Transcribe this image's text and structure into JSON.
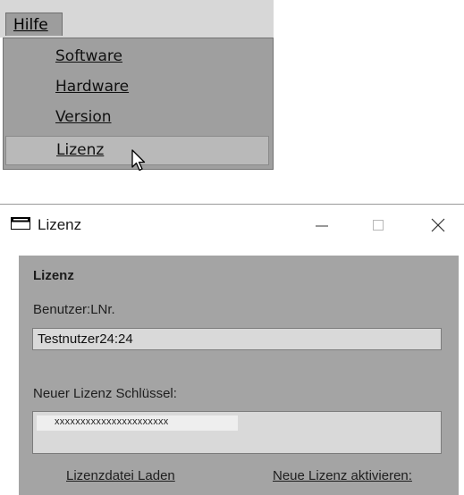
{
  "menu": {
    "top_label": "Hilfe",
    "items": [
      {
        "label": "Software"
      },
      {
        "label": "Hardware"
      },
      {
        "label": "Version"
      },
      {
        "label": "Lizenz",
        "highlighted": true
      }
    ]
  },
  "dialog": {
    "title": "Lizenz",
    "window_controls": {
      "minimize_icon": "minimize-icon",
      "maximize_icon": "maximize-icon",
      "close_icon": "close-icon"
    },
    "group_title": "Lizenz",
    "user_label": "Benutzer:LNr.",
    "user_value": "Testnutzer24:24",
    "key_label": "Neuer Lizenz Schlüssel:",
    "key_value": "xxxxxxxxxxxxxxxxxxxxxx",
    "load_link": "Lizenzdatei Laden",
    "activate_link": "Neue Lizenz aktivieren:"
  },
  "colors": {
    "menu_background": "#9f9f9f",
    "menu_hover": "#b9b9b9",
    "dialog_client": "#a4a4a4",
    "field_background": "#d9d9d9"
  }
}
